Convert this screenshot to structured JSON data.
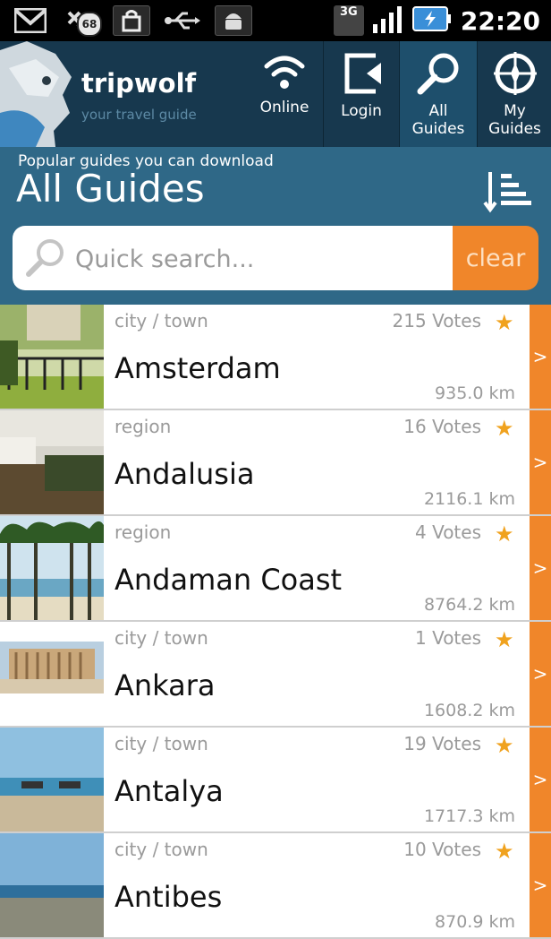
{
  "status_bar": {
    "time": "22:20",
    "notification_count": "68",
    "network": "3G",
    "icons": [
      "gmail-icon",
      "missed-call-icon",
      "shopping-bag-icon",
      "usb-icon",
      "android-icon",
      "3g-icon",
      "signal-icon",
      "battery-icon"
    ]
  },
  "header": {
    "app_name": "tripwolf",
    "tagline": "your travel guide",
    "nav": [
      {
        "label": "Online",
        "icon": "wifi-icon"
      },
      {
        "label": "Login",
        "icon": "login-icon"
      },
      {
        "label": "All Guides",
        "icon": "search-icon",
        "active": true
      },
      {
        "label": "My Guides",
        "icon": "compass-icon"
      }
    ]
  },
  "page": {
    "subtitle": "Popular guides you can download",
    "title": "All Guides"
  },
  "search": {
    "placeholder": "Quick search...",
    "clear_label": "clear"
  },
  "guides": [
    {
      "type": "city / town",
      "votes": "215 Votes",
      "name": "Amsterdam",
      "distance": "935.0 km"
    },
    {
      "type": "region",
      "votes": "16 Votes",
      "name": "Andalusia",
      "distance": "2116.1 km"
    },
    {
      "type": "region",
      "votes": "4 Votes",
      "name": "Andaman Coast",
      "distance": "8764.2 km"
    },
    {
      "type": "city / town",
      "votes": "1 Votes",
      "name": "Ankara",
      "distance": "1608.2 km"
    },
    {
      "type": "city / town",
      "votes": "19 Votes",
      "name": "Antalya",
      "distance": "1717.3 km"
    },
    {
      "type": "city / town",
      "votes": "10 Votes",
      "name": "Antibes",
      "distance": "870.9 km"
    }
  ],
  "row_arrow": ">",
  "star": "★",
  "colors": {
    "header": "#17384e",
    "band": "#2f6887",
    "accent": "#f0862a",
    "star": "#f0a21e"
  }
}
